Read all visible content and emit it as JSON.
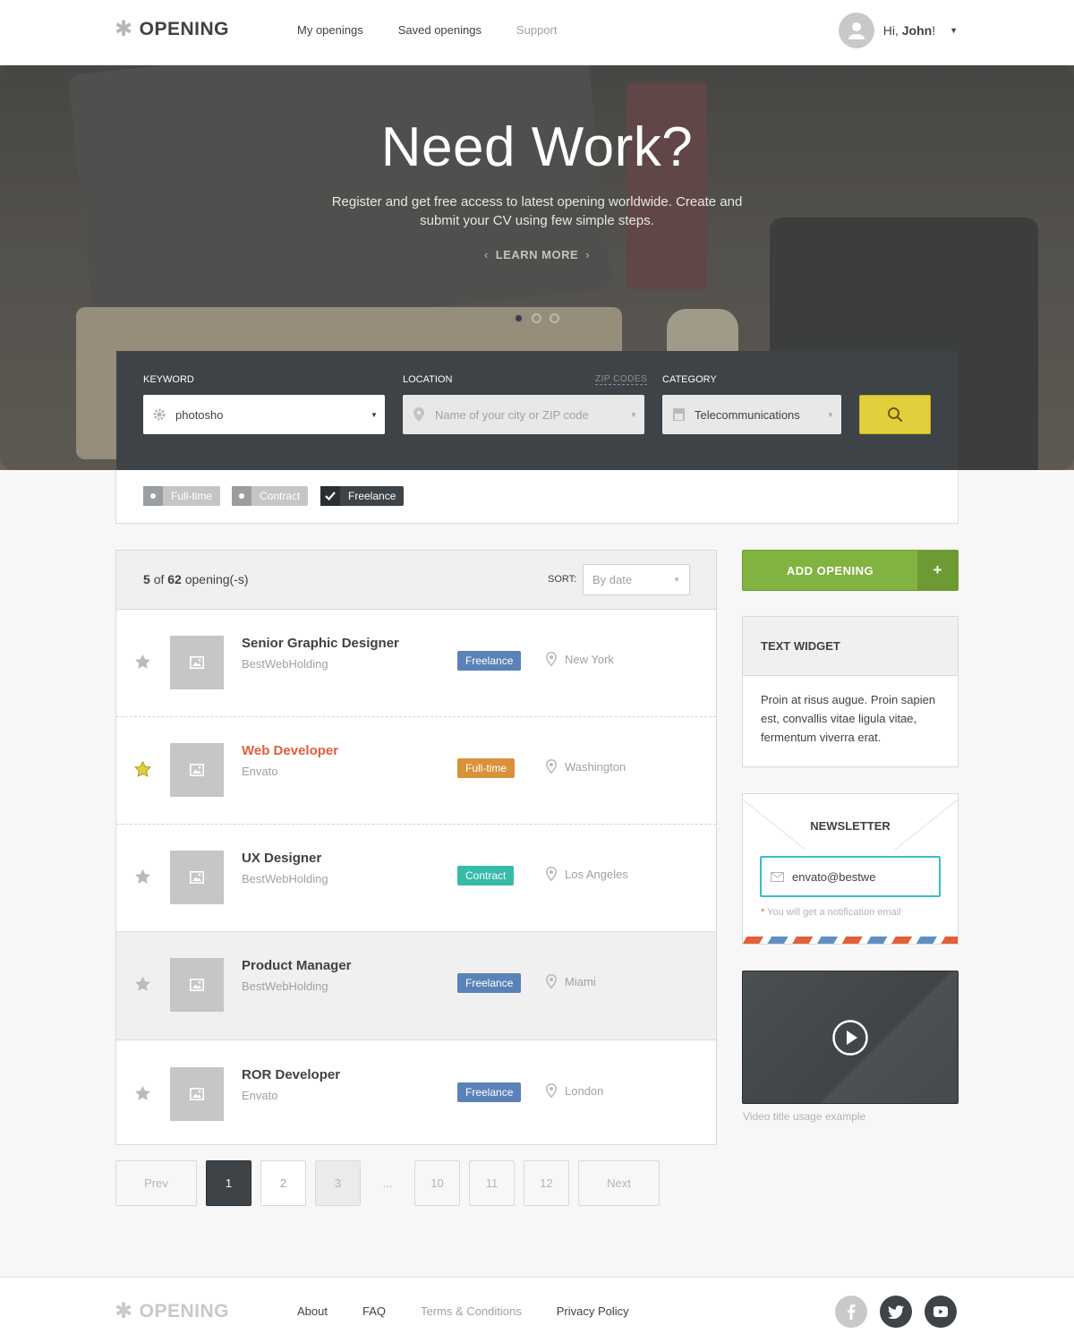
{
  "header": {
    "logo": "OPENING",
    "nav": [
      "My openings",
      "Saved openings",
      "Support"
    ],
    "greeting": "Hi,",
    "user_name": "John",
    "greeting_end": "!"
  },
  "hero": {
    "title": "Need Work?",
    "subtitle": "Register and get free access to latest opening worldwide. Create and submit your CV using few simple steps.",
    "learn_more": "LEARN MORE",
    "slides": 3,
    "active_slide": 1
  },
  "search": {
    "keyword_label": "KEYWORD",
    "keyword_value": "photosho",
    "location_label": "LOCATION",
    "zip_link": "ZIP CODES",
    "location_placeholder": "Name of your city or ZIP code",
    "category_label": "CATEGORY",
    "category_value": "Telecommunications"
  },
  "filters": [
    {
      "label": "Full-time",
      "checked": false
    },
    {
      "label": "Contract",
      "checked": false
    },
    {
      "label": "Freelance",
      "checked": true
    }
  ],
  "listing": {
    "count_shown": "5",
    "count_of": "of",
    "count_total": "62",
    "count_suffix": "opening(-s)",
    "sort_label": "SORT:",
    "sort_value": "By date"
  },
  "jobs": [
    {
      "title": "Senior Graphic Designer",
      "company": "BestWebHolding",
      "type": "Freelance",
      "type_color": "#5b82b8",
      "location": "New York",
      "starred": false
    },
    {
      "title": "Web Developer",
      "company": "Envato",
      "type": "Full-time",
      "type_color": "#d9923a",
      "location": "Washington",
      "starred": true
    },
    {
      "title": "UX Designer",
      "company": "BestWebHolding",
      "type": "Contract",
      "type_color": "#36bba8",
      "location": "Los Angeles",
      "starred": false
    },
    {
      "title": "Product Manager",
      "company": "BestWebHolding",
      "type": "Freelance",
      "type_color": "#5b82b8",
      "location": "Miami",
      "starred": false
    },
    {
      "title": "ROR Developer",
      "company": "Envato",
      "type": "Freelance",
      "type_color": "#5b82b8",
      "location": "London",
      "starred": false
    }
  ],
  "pagination": {
    "prev": "Prev",
    "pages": [
      "1",
      "2",
      "3",
      "...",
      "10",
      "11",
      "12"
    ],
    "current": "1",
    "next": "Next"
  },
  "sidebar": {
    "add_opening": "ADD OPENING",
    "add_plus": "+",
    "widget_title": "TEXT WIDGET",
    "widget_text": "Proin at risus augue. Proin sapien est, convallis vitae ligula vitae, fermentum viverra erat.",
    "newsletter_title": "NEWSLETTER",
    "newsletter_value": "envato@bestwe",
    "newsletter_req": "*",
    "newsletter_note": "You will get a notification email",
    "video_caption": "Video title usage example"
  },
  "footer": {
    "logo": "OPENING",
    "links": [
      "About",
      "FAQ",
      "Terms & Conditions",
      "Privacy Policy"
    ],
    "social": [
      "facebook-icon",
      "twitter-icon",
      "youtube-icon"
    ]
  },
  "colors": {
    "accent_red": "#e2603a",
    "search_yellow": "#e2cf3b",
    "add_green": "#82b341",
    "dark": "#3d4347",
    "newsletter_focus": "#3bbcc7"
  }
}
